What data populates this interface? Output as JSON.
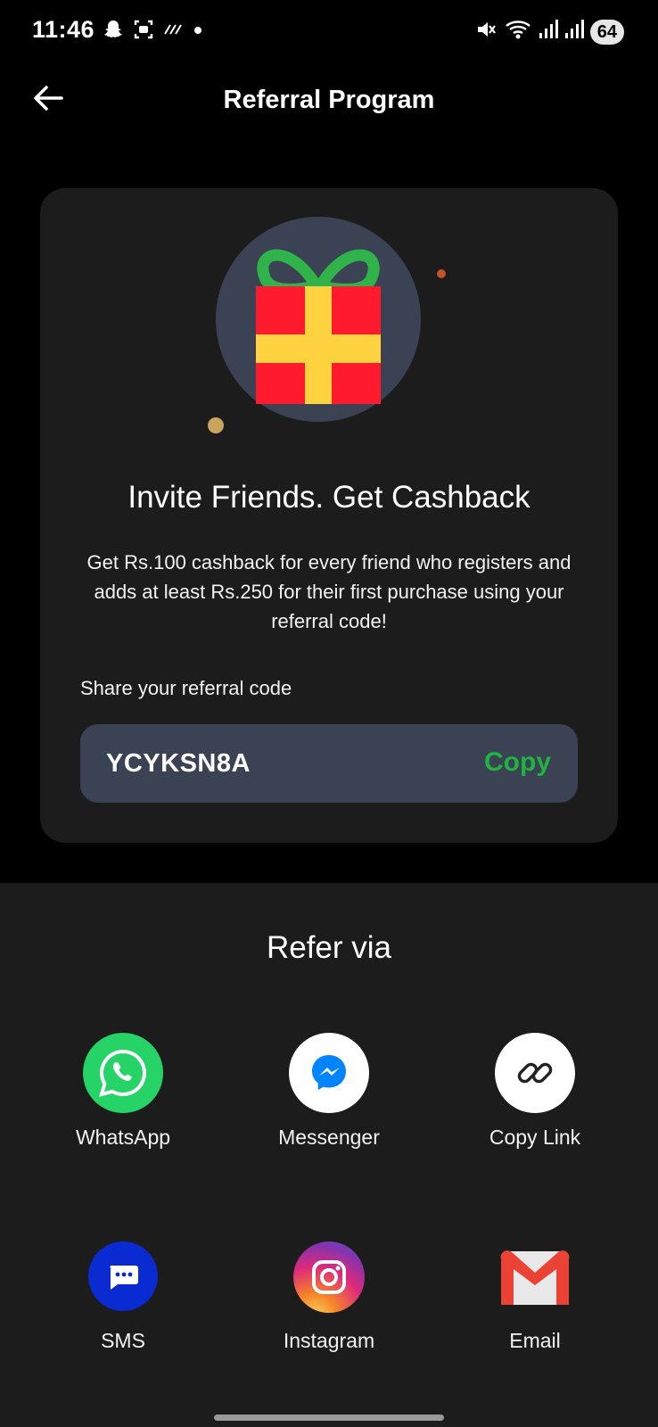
{
  "status_bar": {
    "time": "11:46",
    "battery": "64",
    "left_icons": [
      "snapchat-icon",
      "screenshot-icon",
      "nfc-icon",
      "dot-icon"
    ],
    "right_icons": [
      "mute-icon",
      "wifi-icon",
      "signal-icon",
      "signal-icon"
    ]
  },
  "app_bar": {
    "title": "Referral Program",
    "back_icon": "arrow-left-icon"
  },
  "card": {
    "illustration": "gift-icon",
    "title": "Invite Friends. Get Cashback",
    "description": "Get Rs.100 cashback for every friend who registers and adds at least Rs.250 for their first purchase using your referral code!",
    "share_label": "Share your referral code",
    "code": "YCYKSN8A",
    "copy_label": "Copy"
  },
  "sheet": {
    "title": "Refer via",
    "options": [
      {
        "label": "WhatsApp",
        "icon": "whatsapp-icon",
        "color": "#25d366"
      },
      {
        "label": "Messenger",
        "icon": "messenger-icon",
        "color": "#0084ff"
      },
      {
        "label": "Copy Link",
        "icon": "link-icon",
        "color": "#ffffff"
      },
      {
        "label": "SMS",
        "icon": "sms-icon",
        "color": "#0a2bd1"
      },
      {
        "label": "Instagram",
        "icon": "instagram-icon",
        "color": "#d62976"
      },
      {
        "label": "Email",
        "icon": "gmail-icon",
        "color": "#ea4335"
      }
    ]
  },
  "colors": {
    "background": "#000000",
    "card": "#1c1c1c",
    "code_box": "#3a4253",
    "accent_green": "#1fb33f",
    "gift_red": "#ff1a2e",
    "gift_yellow": "#ffd23f",
    "gift_ribbon": "#2fb34a"
  }
}
